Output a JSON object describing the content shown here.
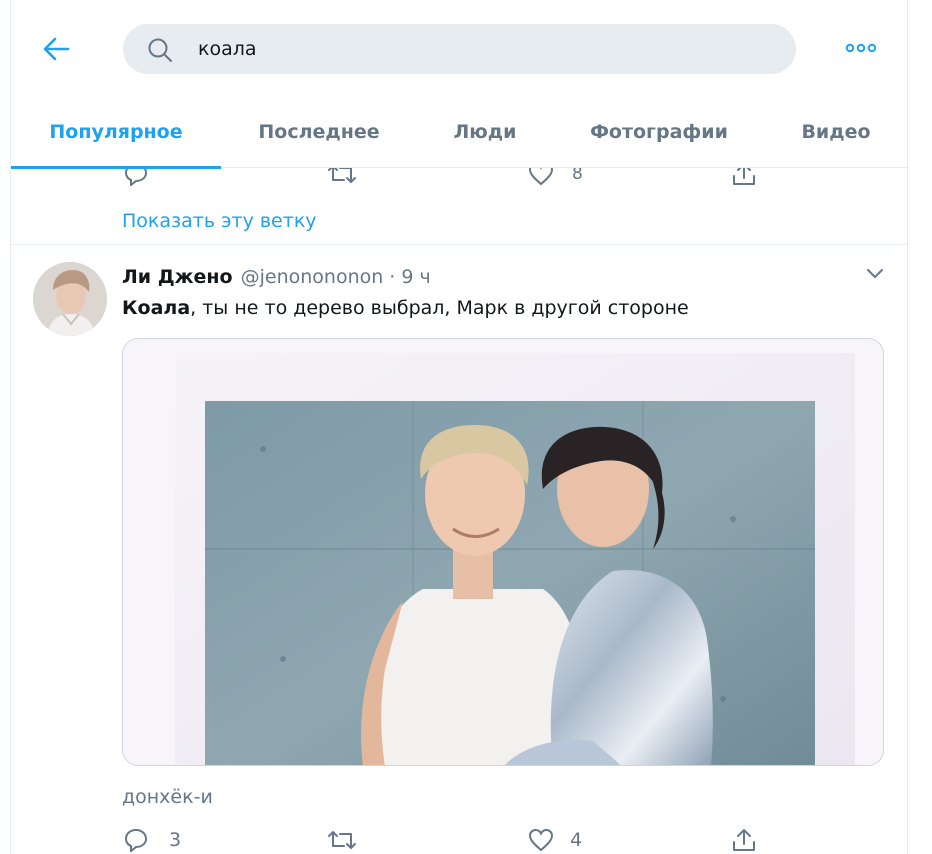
{
  "search": {
    "query": "коала"
  },
  "tabs": [
    {
      "label": "Популярное",
      "active": true
    },
    {
      "label": "Последнее",
      "active": false
    },
    {
      "label": "Люди",
      "active": false
    },
    {
      "label": "Фотографии",
      "active": false
    },
    {
      "label": "Видео",
      "active": false
    }
  ],
  "prev_tweet": {
    "like_count": "8",
    "show_thread_label": "Показать эту ветку"
  },
  "tweet": {
    "author_name": "Ли Джено",
    "author_handle": "@jenonononon",
    "separator": "·",
    "time": "9 ч",
    "text_bold": "Коала",
    "text_rest": ", ты не то дерево выбрал, Марк в другой стороне",
    "translated_tag": "донхёк-и",
    "reply_count": "3",
    "retweet_count": "",
    "like_count": "4"
  },
  "colors": {
    "accent": "#1da1f2",
    "muted": "#657786",
    "border": "#e6ecf0",
    "search_bg": "#e6ecf0"
  },
  "icons": [
    "back-arrow-icon",
    "search-icon",
    "more-icon",
    "chevron-down-icon",
    "reply-icon",
    "retweet-icon",
    "like-icon",
    "share-icon"
  ]
}
